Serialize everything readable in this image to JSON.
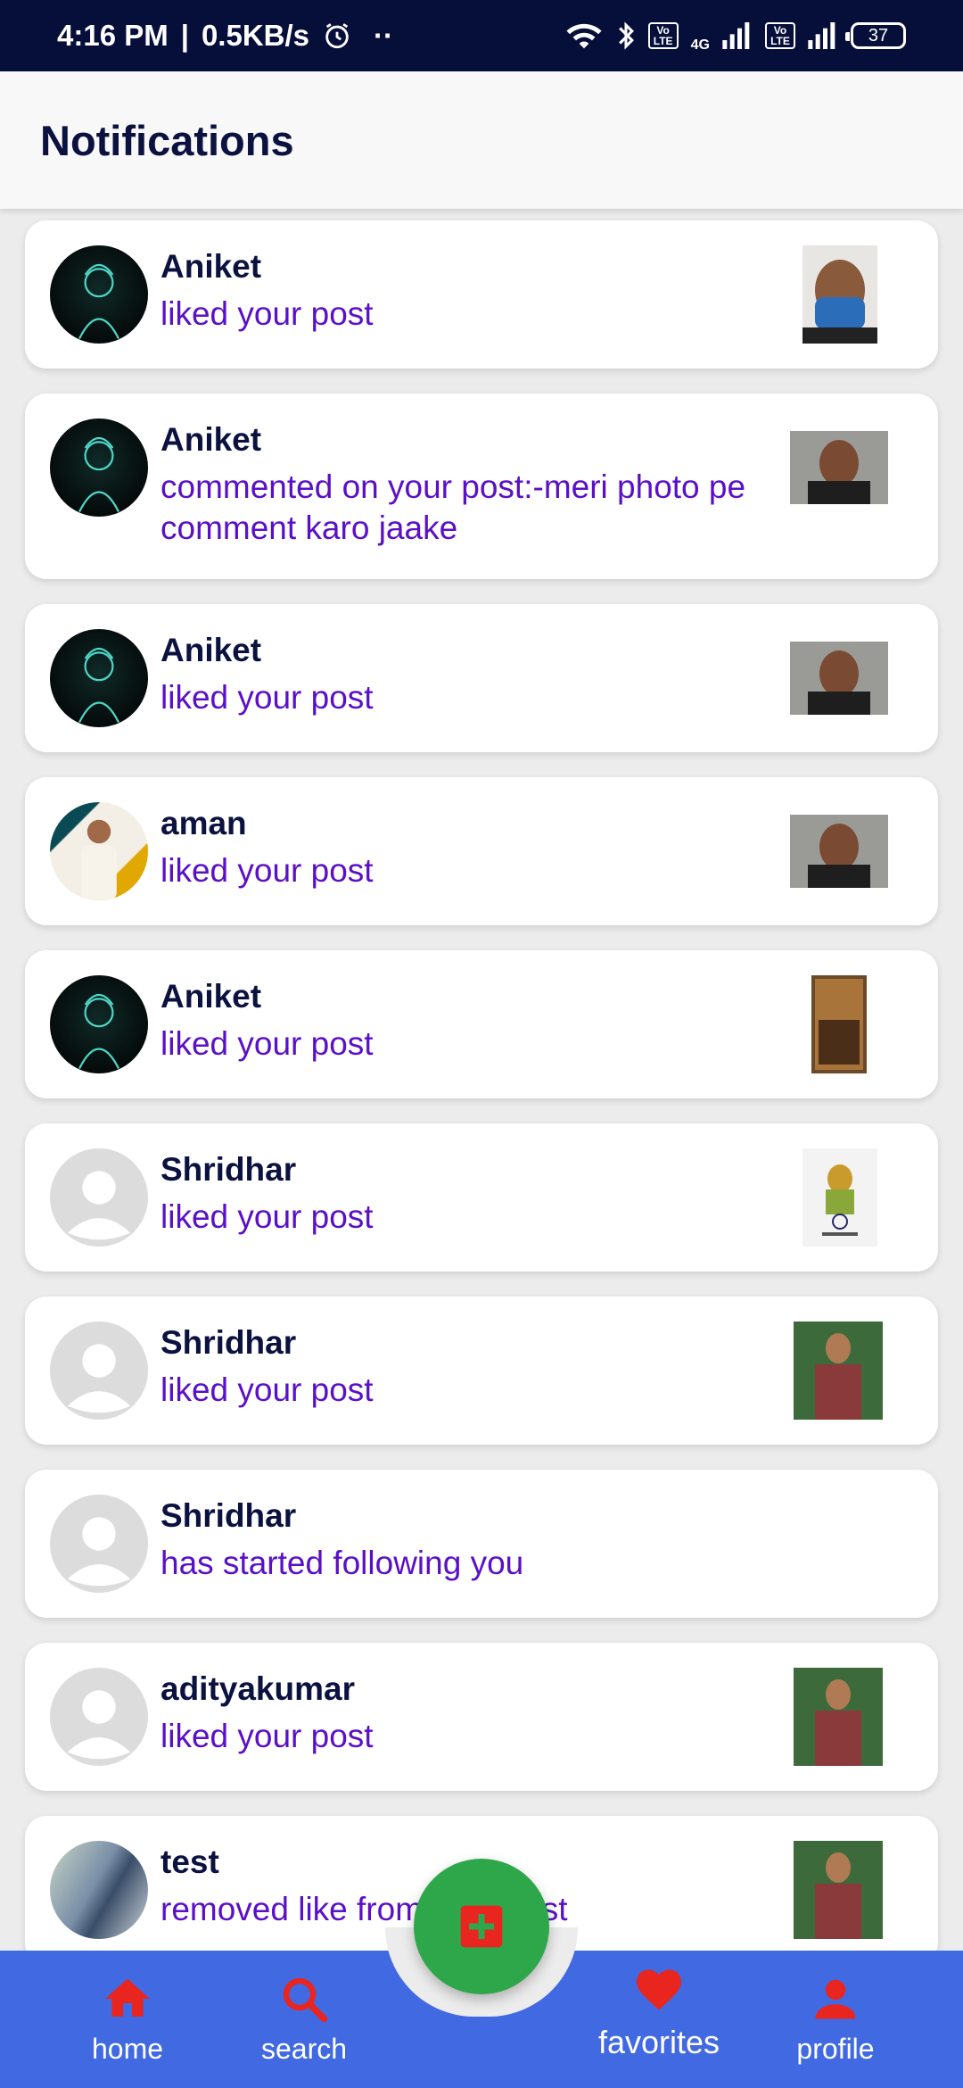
{
  "status_bar": {
    "time": "4:16 PM",
    "speed": "0.5KB/s",
    "network": "4G",
    "volte_label": "Vo LTE",
    "battery": "37"
  },
  "header": {
    "title": "Notifications"
  },
  "notifications": [
    {
      "name": "Aniket",
      "action": "liked your post"
    },
    {
      "name": "Aniket",
      "action": "commented on your post:-meri photo pe comment karo jaake"
    },
    {
      "name": "Aniket",
      "action": "liked your post"
    },
    {
      "name": "aman",
      "action": "liked your post"
    },
    {
      "name": "Aniket",
      "action": "liked your post"
    },
    {
      "name": "Shridhar",
      "action": "liked your post"
    },
    {
      "name": "Shridhar",
      "action": "liked your post"
    },
    {
      "name": "Shridhar",
      "action": "has started following you"
    },
    {
      "name": "adityakumar",
      "action": "liked your post"
    },
    {
      "name": "test",
      "action": "removed like from your post"
    }
  ],
  "nav": {
    "home": "home",
    "search": "search",
    "favorites": "favorites",
    "profile": "profile"
  },
  "colors": {
    "nav_bg": "#4169e1",
    "fab_bg": "#2ea64a",
    "action_text": "#5a0fc8",
    "name_text": "#0c1240",
    "status_bar_bg": "#060e3a"
  },
  "icons": {
    "home": "home-icon",
    "search": "search-icon",
    "favorites": "heart-icon",
    "profile": "person-icon",
    "fab": "add-box-icon"
  }
}
